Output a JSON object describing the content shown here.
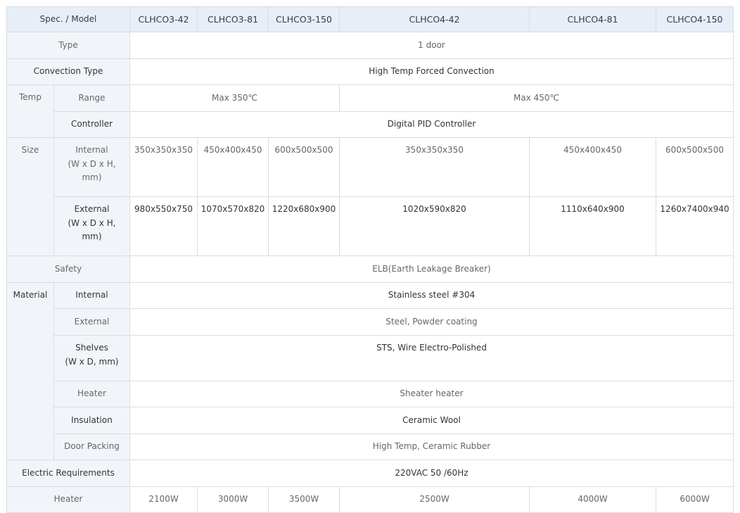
{
  "header": {
    "spec_label": "Spec. / Model",
    "models": [
      "CLHCO3-42",
      "CLHCO3-81",
      "CLHCO3-150",
      "CLHCO4-42",
      "CLHCO4-81",
      "CLHCO4-150"
    ]
  },
  "type": {
    "label": "Type",
    "value": "1 door"
  },
  "convection": {
    "label": "Convection Type",
    "value": "High Temp Forced Convection"
  },
  "temp": {
    "group": "Temp",
    "range_label": "Range",
    "range_clhco3": "Max 350℃",
    "range_clhco4": "Max 450℃",
    "controller_label": "Controller",
    "controller_value": "Digital PID Controller"
  },
  "size": {
    "group": "Size",
    "internal_label_line1": "Internal",
    "internal_label_line2": "(W x D x H,",
    "internal_label_line3": "mm)",
    "internal_values": [
      "350x350x350",
      "450x400x450",
      "600x500x500",
      "350x350x350",
      "450x400x450",
      "600x500x500"
    ],
    "external_label_line1": "External",
    "external_label_line2": "(W x D x H,",
    "external_label_line3": "mm)",
    "external_values": [
      "980x550x750",
      "1070x570x820",
      "1220x680x900",
      "1020x590x820",
      "1110x640x900",
      "1260x7400x940"
    ]
  },
  "safety": {
    "label": "Safety",
    "value": "ELB(Earth Leakage Breaker)"
  },
  "material": {
    "group": "Material",
    "internal_label": "Internal",
    "internal_value": "Stainless steel #304",
    "external_label": "External",
    "external_value": "Steel, Powder coating",
    "shelves_label_line1": "Shelves",
    "shelves_label_line2": "(W x D, mm)",
    "shelves_value": "STS, Wire Electro-Polished",
    "heater_label": "Heater",
    "heater_value": "Sheater heater",
    "insulation_label": "Insulation",
    "insulation_value": "Ceramic Wool",
    "door_packing_label": "Door Packing",
    "door_packing_value": "High Temp, Ceramic Rubber"
  },
  "electric": {
    "label": "Electric Requirements",
    "value": "220VAC 50 /60Hz"
  },
  "heater": {
    "label": "Heater",
    "values": [
      "2100W",
      "3000W",
      "3500W",
      "2500W",
      "4000W",
      "6000W"
    ]
  }
}
